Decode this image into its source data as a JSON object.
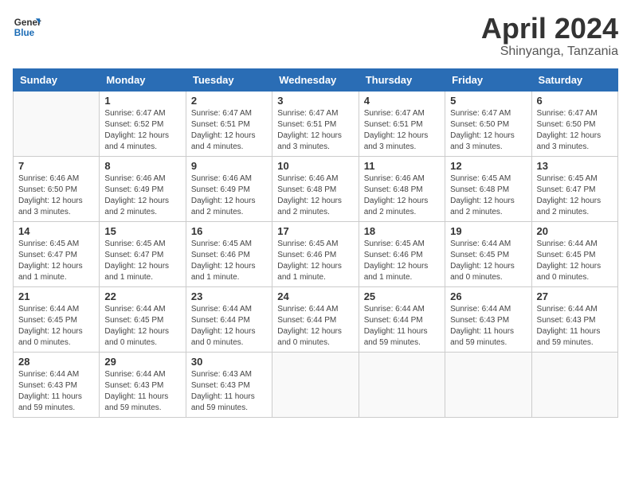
{
  "header": {
    "logo_general": "General",
    "logo_blue": "Blue",
    "month_title": "April 2024",
    "subtitle": "Shinyanga, Tanzania"
  },
  "columns": [
    "Sunday",
    "Monday",
    "Tuesday",
    "Wednesday",
    "Thursday",
    "Friday",
    "Saturday"
  ],
  "weeks": [
    [
      {
        "day": "",
        "info": ""
      },
      {
        "day": "1",
        "info": "Sunrise: 6:47 AM\nSunset: 6:52 PM\nDaylight: 12 hours\nand 4 minutes."
      },
      {
        "day": "2",
        "info": "Sunrise: 6:47 AM\nSunset: 6:51 PM\nDaylight: 12 hours\nand 4 minutes."
      },
      {
        "day": "3",
        "info": "Sunrise: 6:47 AM\nSunset: 6:51 PM\nDaylight: 12 hours\nand 3 minutes."
      },
      {
        "day": "4",
        "info": "Sunrise: 6:47 AM\nSunset: 6:51 PM\nDaylight: 12 hours\nand 3 minutes."
      },
      {
        "day": "5",
        "info": "Sunrise: 6:47 AM\nSunset: 6:50 PM\nDaylight: 12 hours\nand 3 minutes."
      },
      {
        "day": "6",
        "info": "Sunrise: 6:47 AM\nSunset: 6:50 PM\nDaylight: 12 hours\nand 3 minutes."
      }
    ],
    [
      {
        "day": "7",
        "info": "Sunrise: 6:46 AM\nSunset: 6:50 PM\nDaylight: 12 hours\nand 3 minutes."
      },
      {
        "day": "8",
        "info": "Sunrise: 6:46 AM\nSunset: 6:49 PM\nDaylight: 12 hours\nand 2 minutes."
      },
      {
        "day": "9",
        "info": "Sunrise: 6:46 AM\nSunset: 6:49 PM\nDaylight: 12 hours\nand 2 minutes."
      },
      {
        "day": "10",
        "info": "Sunrise: 6:46 AM\nSunset: 6:48 PM\nDaylight: 12 hours\nand 2 minutes."
      },
      {
        "day": "11",
        "info": "Sunrise: 6:46 AM\nSunset: 6:48 PM\nDaylight: 12 hours\nand 2 minutes."
      },
      {
        "day": "12",
        "info": "Sunrise: 6:45 AM\nSunset: 6:48 PM\nDaylight: 12 hours\nand 2 minutes."
      },
      {
        "day": "13",
        "info": "Sunrise: 6:45 AM\nSunset: 6:47 PM\nDaylight: 12 hours\nand 2 minutes."
      }
    ],
    [
      {
        "day": "14",
        "info": "Sunrise: 6:45 AM\nSunset: 6:47 PM\nDaylight: 12 hours\nand 1 minute."
      },
      {
        "day": "15",
        "info": "Sunrise: 6:45 AM\nSunset: 6:47 PM\nDaylight: 12 hours\nand 1 minute."
      },
      {
        "day": "16",
        "info": "Sunrise: 6:45 AM\nSunset: 6:46 PM\nDaylight: 12 hours\nand 1 minute."
      },
      {
        "day": "17",
        "info": "Sunrise: 6:45 AM\nSunset: 6:46 PM\nDaylight: 12 hours\nand 1 minute."
      },
      {
        "day": "18",
        "info": "Sunrise: 6:45 AM\nSunset: 6:46 PM\nDaylight: 12 hours\nand 1 minute."
      },
      {
        "day": "19",
        "info": "Sunrise: 6:44 AM\nSunset: 6:45 PM\nDaylight: 12 hours\nand 0 minutes."
      },
      {
        "day": "20",
        "info": "Sunrise: 6:44 AM\nSunset: 6:45 PM\nDaylight: 12 hours\nand 0 minutes."
      }
    ],
    [
      {
        "day": "21",
        "info": "Sunrise: 6:44 AM\nSunset: 6:45 PM\nDaylight: 12 hours\nand 0 minutes."
      },
      {
        "day": "22",
        "info": "Sunrise: 6:44 AM\nSunset: 6:45 PM\nDaylight: 12 hours\nand 0 minutes."
      },
      {
        "day": "23",
        "info": "Sunrise: 6:44 AM\nSunset: 6:44 PM\nDaylight: 12 hours\nand 0 minutes."
      },
      {
        "day": "24",
        "info": "Sunrise: 6:44 AM\nSunset: 6:44 PM\nDaylight: 12 hours\nand 0 minutes."
      },
      {
        "day": "25",
        "info": "Sunrise: 6:44 AM\nSunset: 6:44 PM\nDaylight: 11 hours\nand 59 minutes."
      },
      {
        "day": "26",
        "info": "Sunrise: 6:44 AM\nSunset: 6:43 PM\nDaylight: 11 hours\nand 59 minutes."
      },
      {
        "day": "27",
        "info": "Sunrise: 6:44 AM\nSunset: 6:43 PM\nDaylight: 11 hours\nand 59 minutes."
      }
    ],
    [
      {
        "day": "28",
        "info": "Sunrise: 6:44 AM\nSunset: 6:43 PM\nDaylight: 11 hours\nand 59 minutes."
      },
      {
        "day": "29",
        "info": "Sunrise: 6:44 AM\nSunset: 6:43 PM\nDaylight: 11 hours\nand 59 minutes."
      },
      {
        "day": "30",
        "info": "Sunrise: 6:43 AM\nSunset: 6:43 PM\nDaylight: 11 hours\nand 59 minutes."
      },
      {
        "day": "",
        "info": ""
      },
      {
        "day": "",
        "info": ""
      },
      {
        "day": "",
        "info": ""
      },
      {
        "day": "",
        "info": ""
      }
    ]
  ]
}
